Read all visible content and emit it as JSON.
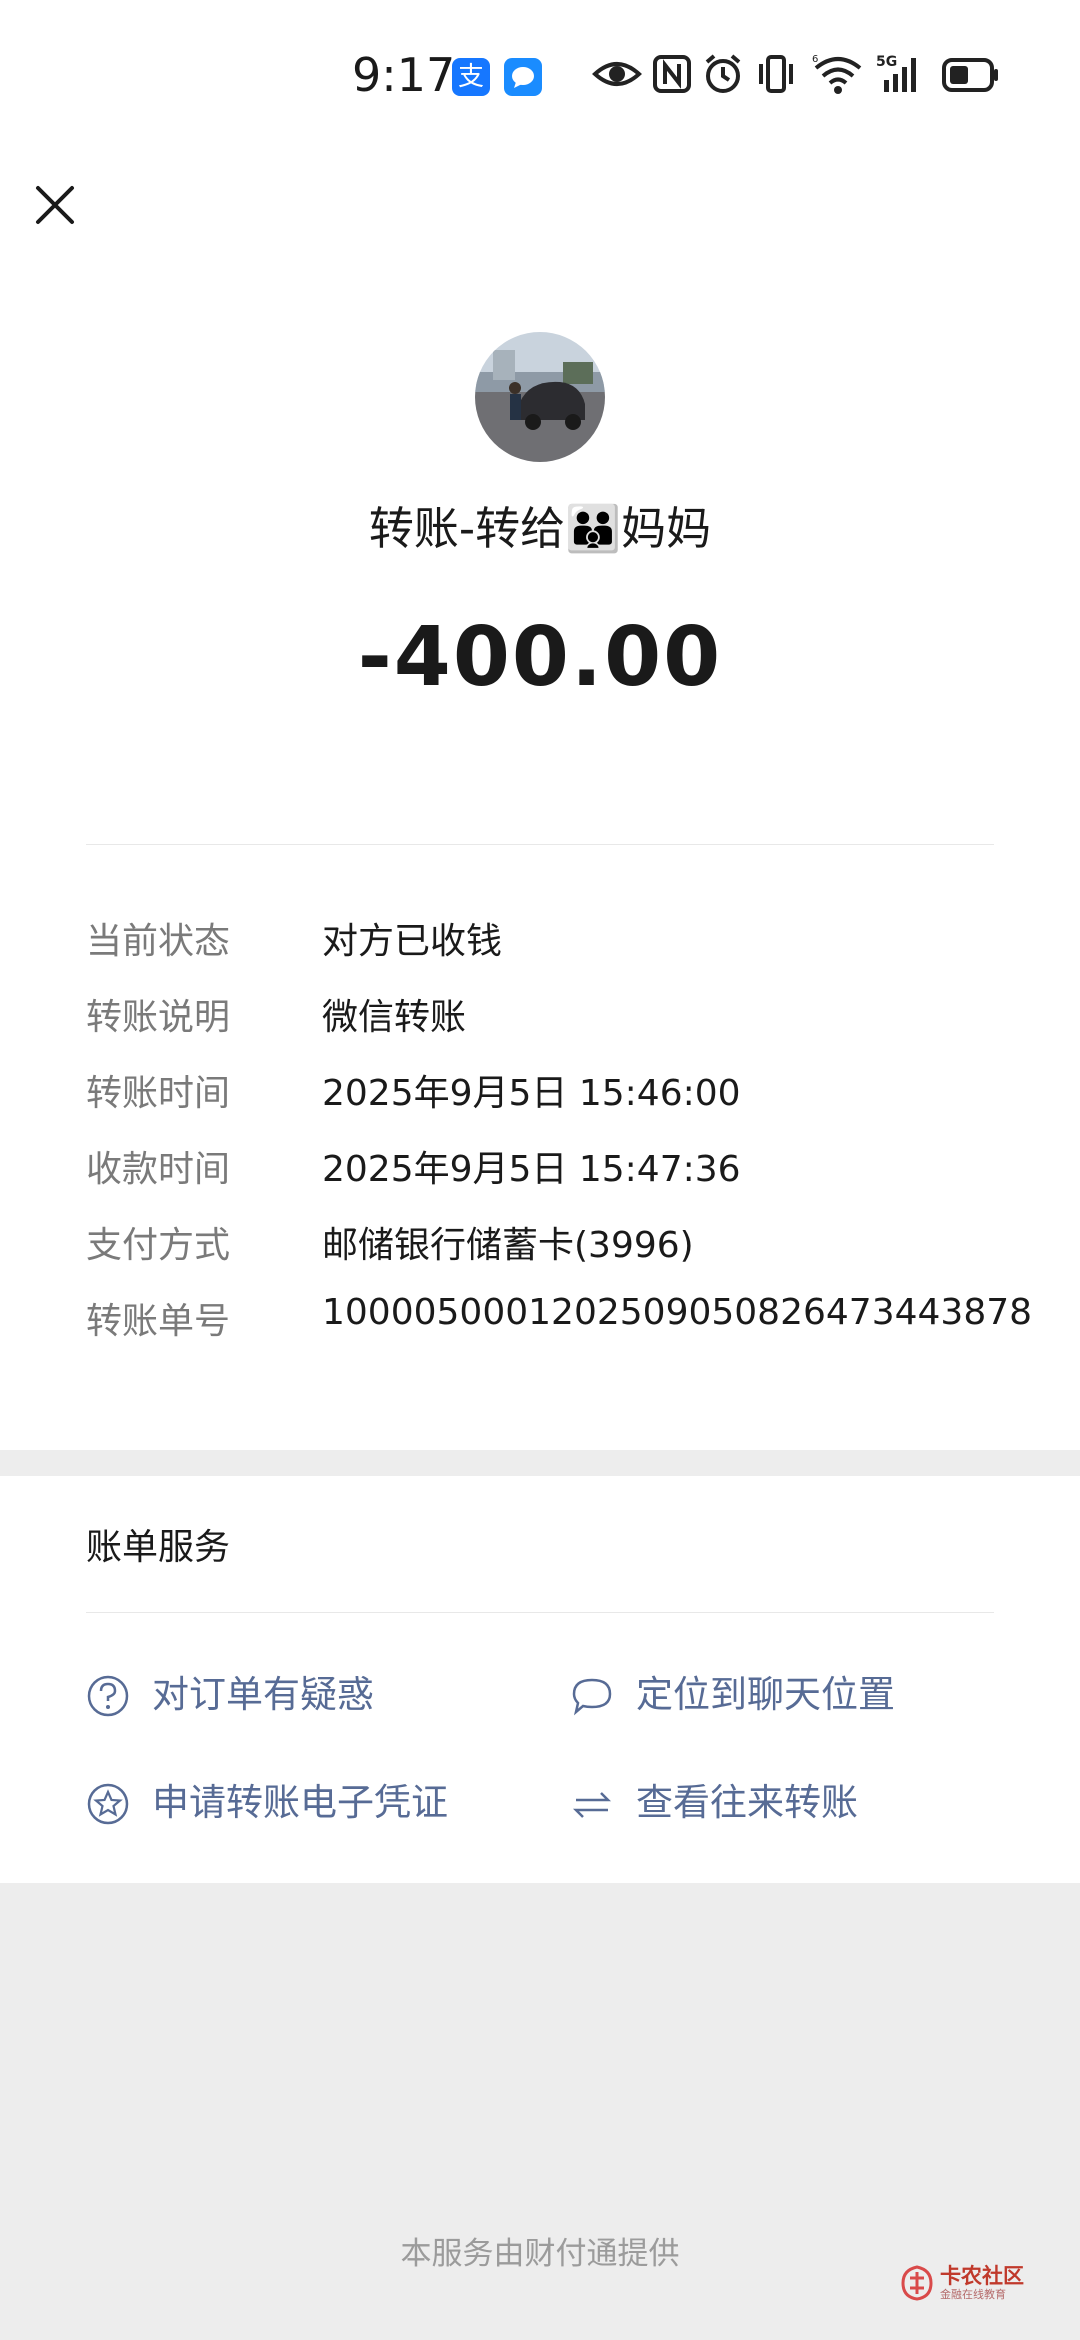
{
  "status_bar": {
    "time": "9:17",
    "app_badges": [
      {
        "icon": "alipay-icon",
        "glyph": "支",
        "color": "#1677ff"
      },
      {
        "icon": "message-icon",
        "glyph": "",
        "color": "#1a8cff"
      }
    ],
    "indicators": [
      "eye-icon",
      "nfc-icon",
      "alarm-icon",
      "vibrate-icon",
      "wifi-icon",
      "signal-5g-icon",
      "battery-icon"
    ],
    "network_label": "5G"
  },
  "header": {
    "close_icon": "close-icon"
  },
  "transfer": {
    "title_prefix": "转账-转给",
    "title_emoji": "👪",
    "title_name": "妈妈",
    "amount": "-400.00",
    "details": [
      {
        "label": "当前状态",
        "value": "对方已收钱"
      },
      {
        "label": "转账说明",
        "value": "微信转账"
      },
      {
        "label": "转账时间",
        "value": "2025年9月5日 15:46:00"
      },
      {
        "label": "收款时间",
        "value": "2025年9月5日 15:47:36"
      },
      {
        "label": "支付方式",
        "value": "邮储银行储蓄卡(3996)"
      },
      {
        "label": "转账单号",
        "value": "100005000120250905082647344387​8"
      }
    ]
  },
  "services": {
    "title": "账单服务",
    "items": [
      {
        "label": "对订单有疑惑",
        "icon": "question-icon"
      },
      {
        "label": "定位到聊天位置",
        "icon": "chat-bubble-icon"
      },
      {
        "label": "申请转账电子凭证",
        "icon": "star-badge-icon"
      },
      {
        "label": "查看往来转账",
        "icon": "swap-arrows-icon"
      }
    ]
  },
  "footer": {
    "text": "本服务由财付通提供"
  },
  "watermark": {
    "title": "卡农社区",
    "subtitle": "金融在线教育",
    "icon": "kanong-logo-icon"
  },
  "colors": {
    "link": "#576b95",
    "label": "#7a7a7a",
    "background": "#ededed"
  }
}
